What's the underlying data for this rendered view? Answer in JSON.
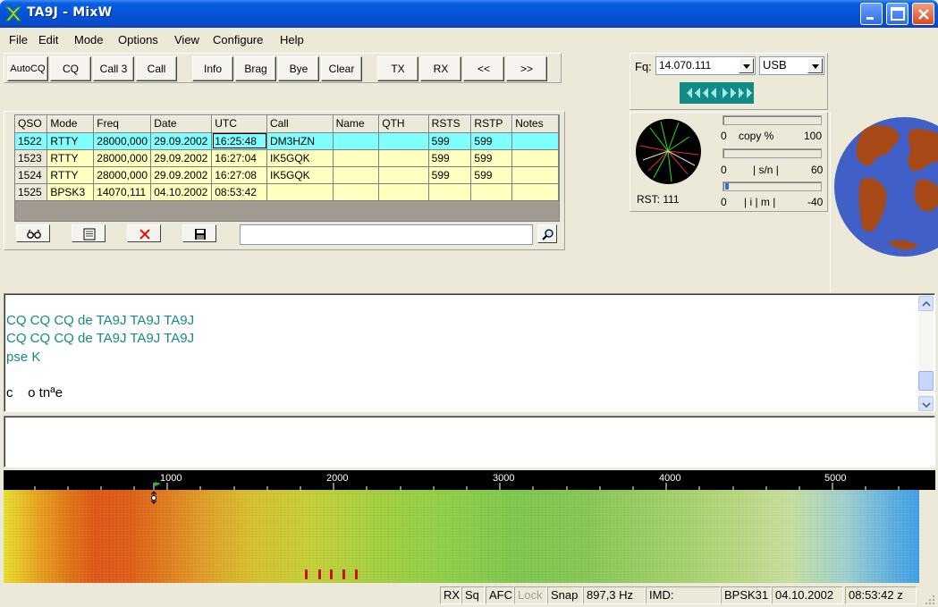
{
  "window": {
    "title": "TA9J - MixW"
  },
  "menu": [
    "File",
    "Edit",
    "Mode",
    "Options",
    "View",
    "Configure",
    "Help"
  ],
  "toolbar": {
    "buttons": [
      "AutoCQ",
      "CQ",
      "Call 3",
      "Call",
      "Info",
      "Brag",
      "Bye",
      "Clear",
      "TX",
      "RX",
      "<<",
      ">>"
    ]
  },
  "log": {
    "columns": [
      "QSO",
      "Mode",
      "Freq",
      "Date",
      "UTC",
      "Call",
      "Name",
      "QTH",
      "RSTS",
      "RSTP",
      "Notes"
    ],
    "rows": [
      [
        "1522",
        "RTTY",
        "28000,000",
        "29.09.2002",
        "16:25:48",
        "DM3HZN",
        "",
        "",
        "599",
        "599",
        ""
      ],
      [
        "1523",
        "RTTY",
        "28000,000",
        "29.09.2002",
        "16:27:04",
        "IK5GQK",
        "",
        "",
        "599",
        "599",
        ""
      ],
      [
        "1524",
        "RTTY",
        "28000,000",
        "29.09.2002",
        "16:27:08",
        "IK5GQK",
        "",
        "",
        "599",
        "599",
        ""
      ],
      [
        "1525",
        "BPSK3",
        "14070,111",
        "04.10.2002",
        "08:53:42",
        "",
        "",
        "",
        "",
        "",
        ""
      ]
    ],
    "search_value": ""
  },
  "frequency": {
    "label": "Fq:",
    "value": "14.070.111",
    "sideband": "USB"
  },
  "meters": {
    "rst_text": "RST: 111",
    "copy": {
      "min": "0",
      "label": "copy %",
      "max": "100",
      "level": 0
    },
    "sn": {
      "min": "0",
      "label": "| s/n |",
      "max": "60",
      "level": 0
    },
    "imd": {
      "min": "0",
      "label": "| i | m |",
      "max": "-40",
      "level": 0.04
    }
  },
  "rx_text": {
    "lines": [
      {
        "text": "CQ CQ CQ de TA9J TA9J TA9J",
        "kind": "tx"
      },
      {
        "text": "CQ CQ CQ de TA9J TA9J TA9J",
        "kind": "tx"
      },
      {
        "text": "pse K",
        "kind": "tx"
      },
      {
        "text": "c    o tnªe",
        "kind": "rx"
      }
    ]
  },
  "waterfall": {
    "ticks": [
      "1000",
      "2000",
      "3000",
      "4000",
      "5000"
    ]
  },
  "status": {
    "rx": "RX",
    "sq": "Sq",
    "afc": "AFC",
    "lock": "Lock",
    "snap": "Snap",
    "freq": "897,3 Hz",
    "imd": "IMD:",
    "mode": "BPSK31",
    "date": "04.10.2002",
    "time": "08:53:42 z"
  },
  "colors": {
    "title_bar": "#0553d8",
    "tx_text": "#158a86",
    "selected_row": "#80ffff",
    "log_rows": "#ffffc0"
  }
}
